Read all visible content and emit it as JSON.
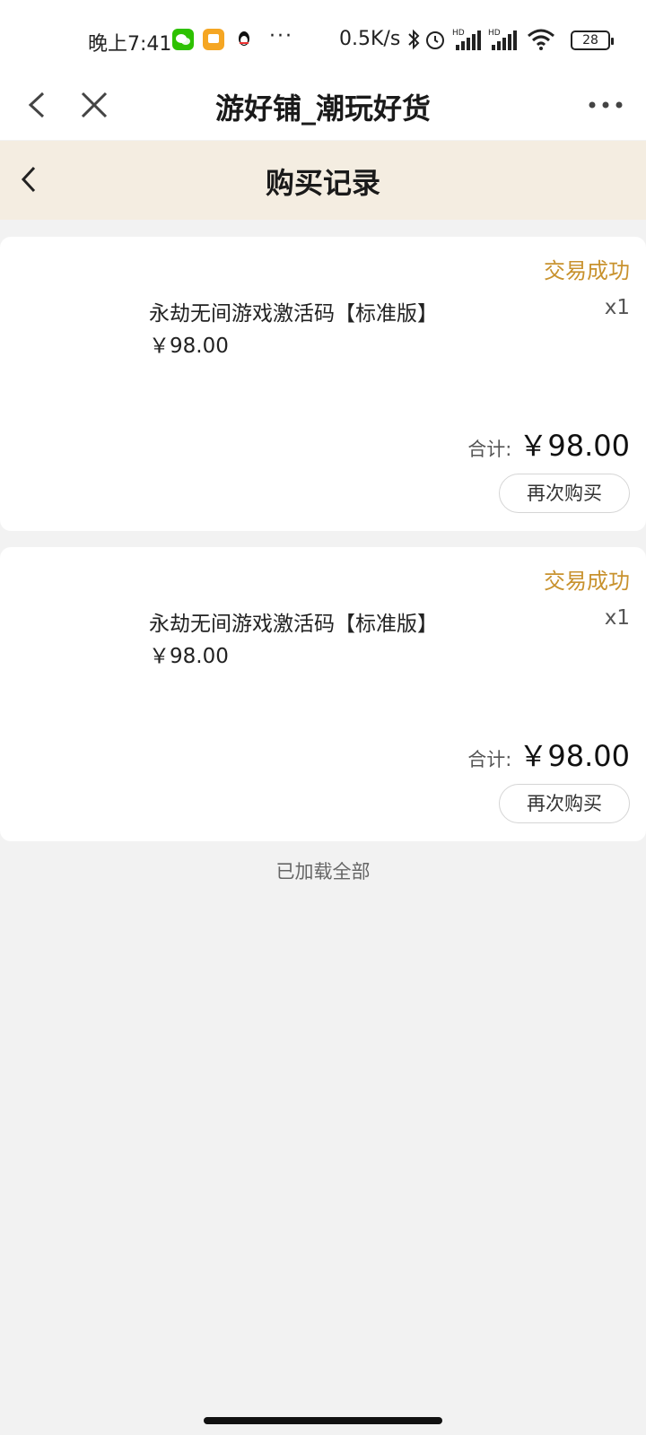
{
  "status_bar": {
    "time": "晚上7:41",
    "more": "···",
    "net_speed": "0.5K/s",
    "battery": "28"
  },
  "title_bar": {
    "title": "游好铺_潮玩好货"
  },
  "page_header": {
    "title": "购买记录"
  },
  "orders": [
    {
      "status": "交易成功",
      "product_name": "永劫无间游戏激活码【标准版】",
      "quantity": "x1",
      "unit_price": "￥98.00",
      "total_label": "合计:",
      "total_value": "￥98.00",
      "rebuy_label": "再次购买"
    },
    {
      "status": "交易成功",
      "product_name": "永劫无间游戏激活码【标准版】",
      "quantity": "x1",
      "unit_price": "￥98.00",
      "total_label": "合计:",
      "total_value": "￥98.00",
      "rebuy_label": "再次购买"
    }
  ],
  "footer": {
    "loaded_text": "已加载全部"
  },
  "colors": {
    "status_accent": "#c8922e",
    "header_bg": "#f4ede1",
    "page_bg": "#f2f2f2"
  }
}
